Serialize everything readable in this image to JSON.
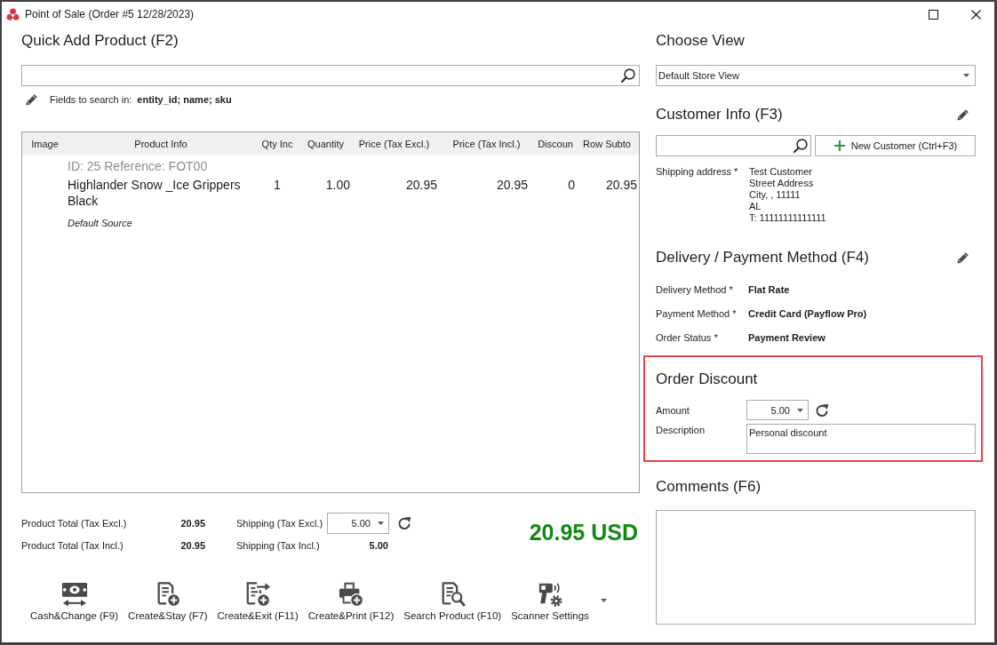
{
  "window": {
    "title": "Point of Sale (Order #5 12/28/2023)"
  },
  "quick_add": {
    "heading": "Quick Add Product (F2)",
    "search_fields_label": "Fields to search in:",
    "search_fields": "entity_id; name; sku"
  },
  "table": {
    "columns": [
      "Image",
      "Product Info",
      "Qty Inc",
      "Quantity",
      "Price (Tax Excl.)",
      "Price (Tax Incl.)",
      "Discoun",
      "Row Subto"
    ],
    "rows": [
      {
        "reference": "ID: 25 Reference: FOT00",
        "cells": [
          "",
          "Highlander Snow _Ice Grippers Black",
          "1",
          "1.00",
          "20.95",
          "20.95",
          "0",
          "20.95"
        ],
        "source": "Default Source"
      }
    ]
  },
  "totals": {
    "rows": [
      {
        "label": "Product Total (Tax Excl.)",
        "value": "20.95",
        "shipping_label": "Shipping (Tax Excl.)",
        "kind": "dropdown",
        "shipping_value": "5.00"
      },
      {
        "label": "Product Total (Tax Incl.)",
        "value": "20.95",
        "shipping_label": "Shipping (Tax Incl.)",
        "kind": "text",
        "shipping_value": "5.00"
      }
    ],
    "grand_total": "20.95 USD"
  },
  "actions": [
    "Cash&Change (F9)",
    "Create&Stay (F7)",
    "Create&Exit (F11)",
    "Create&Print (F12)",
    "Search Product (F10)",
    "Scanner Settings"
  ],
  "choose_view": {
    "heading": "Choose View",
    "value": "Default Store View"
  },
  "customer": {
    "heading": "Customer Info (F3)",
    "new_button": "New Customer (Ctrl+F3)",
    "address_label": "Shipping address *",
    "address_lines": [
      "Test Customer",
      "Street Address",
      "City, , 11111",
      "AL",
      "T: 11111111111111"
    ]
  },
  "delivery_payment": {
    "heading": "Delivery / Payment Method (F4)",
    "fields": [
      {
        "label": "Delivery Method *",
        "value": "Flat Rate"
      },
      {
        "label": "Payment Method *",
        "value": "Credit Card (Payflow Pro)"
      },
      {
        "label": "Order Status *",
        "value": "Payment Review"
      }
    ]
  },
  "order_discount": {
    "heading": "Order Discount",
    "highlighted": true,
    "amount_label": "Amount",
    "amount": "5.00",
    "description_label": "Description",
    "description": "Personal discount"
  },
  "comments": {
    "heading": "Comments (F6)"
  }
}
